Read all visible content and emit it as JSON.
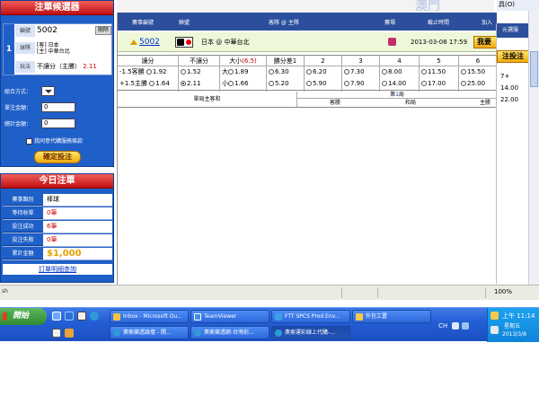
{
  "browser": {
    "tools_label": "具(O)",
    "status_text": "sh",
    "zoom": "100%"
  },
  "header_brand": "澳門",
  "slip": {
    "title": "注單候選器",
    "index": "1",
    "rows": [
      {
        "label": "編號",
        "value": "5002",
        "delete": "刪除"
      },
      {
        "label": "球隊",
        "value_line1": "[客] 日本",
        "value_line2": "[主] 中華台北"
      },
      {
        "label": "玩法",
        "value": "不讓分（主勝）",
        "odds": "2.11"
      }
    ],
    "combo_label": "組合方式：",
    "single_amount_label": "單注金額：",
    "single_amount_value": "0",
    "total_amount_label": "總計金額：",
    "total_amount_value": "0",
    "proxy_checkbox_label": "我同意代購服務條款",
    "confirm_button": "確定投注"
  },
  "today": {
    "title": "今日注單",
    "rows": [
      {
        "label": "賽事類別",
        "value": "棒球"
      },
      {
        "label": "等待收單",
        "value": "0筆"
      },
      {
        "label": "投注成功",
        "value": "6筆"
      },
      {
        "label": "投注失敗",
        "value": "0筆"
      },
      {
        "label": "累計金額",
        "value": "$1,000"
      }
    ],
    "detail_link": "訂單明細查詢"
  },
  "table": {
    "headers": {
      "match_no": "賽事編號",
      "league": "聯盟",
      "teams": "客隊 @ 主隊",
      "venue": "賽場",
      "deadline": "截止時間",
      "add": "加入"
    },
    "match": {
      "no": "5002",
      "teams": "日本 @ 中華台北",
      "deadline": "2013-03-08 17:59",
      "bet_button": "我要"
    },
    "odds_columns": [
      {
        "head": "讓分",
        "r1": "-1.5客勝",
        "o1": "1.92",
        "r2": "+1.5主勝",
        "o2": "1.64"
      },
      {
        "head": "不讓分",
        "r1": "",
        "o1": "1.52",
        "r2": "",
        "o2": "2.11"
      },
      {
        "head": "大小",
        "head_extra": "(6.5)",
        "r1": "大",
        "o1": "1.89",
        "r2": "小",
        "o2": "1.66"
      },
      {
        "head": "勝分差1",
        "r1": "",
        "o1": "6.30",
        "r2": "",
        "o2": "5.20"
      },
      {
        "head": "2",
        "r1": "",
        "o1": "6.20",
        "r2": "",
        "o2": "5.90"
      },
      {
        "head": "3",
        "r1": "",
        "o1": "7.30",
        "r2": "",
        "o2": "7.90"
      },
      {
        "head": "4",
        "r1": "",
        "o1": "8.00",
        "r2": "",
        "o2": "14.00"
      },
      {
        "head": "5",
        "r1": "",
        "o1": "11.50",
        "r2": "",
        "o2": "17.00"
      },
      {
        "head": "6",
        "r1": "",
        "o1": "15.50",
        "r2": "",
        "o2": "25.00"
      }
    ],
    "summary_left": "單局主客和",
    "summary_top_prefix": "第",
    "summary_top_num": "1",
    "summary_top_suffix": "局",
    "summary_away": "客勝",
    "summary_draw": "和局",
    "summary_home": "主勝"
  },
  "right_panel": {
    "head": "元選服",
    "button": "注投注",
    "v1": "7+",
    "v2": "14.00",
    "v3": "22.00"
  },
  "taskbar": {
    "start": "開始",
    "tasks_row1": [
      "Inbox - Microsoft Ou...",
      "TeamViewer",
      "FTT SPCS Prod Env...",
      "外包工置"
    ],
    "tasks_row2": [
      "奧索樂透論壇 - 開...",
      "奧索樂透網-台灣彩...",
      "奧索運彩線上代購-..."
    ],
    "ime": "CH",
    "time": "上午 11:14",
    "weekday": "星期五",
    "date": "2013/3/8"
  }
}
